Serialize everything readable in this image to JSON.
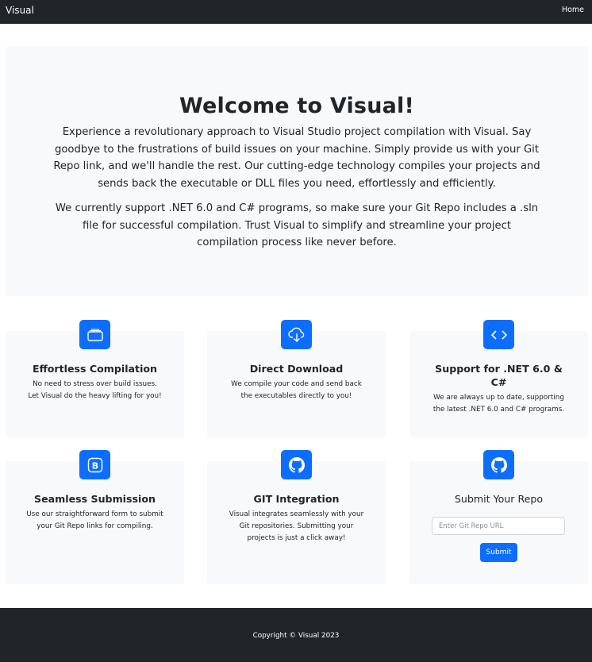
{
  "navbar": {
    "brand": "Visual",
    "links": [
      {
        "label": "Home"
      }
    ]
  },
  "hero": {
    "title": "Welcome to Visual!",
    "paragraphs": [
      "Experience a revolutionary approach to Visual Studio project compilation with Visual. Say goodbye to the frustrations of build issues on your machine. Simply provide us with your Git Repo link, and we'll handle the rest. Our cutting-edge technology compiles your projects and sends back the executable or DLL files you need, effortlessly and efficiently.",
      "We currently support .NET 6.0 and C# programs, so make sure your Git Repo includes a .sln file for successful compilation. Trust Visual to simplify and streamline your project compilation process like never before."
    ]
  },
  "features": [
    {
      "icon": "folder-icon",
      "title": "Effortless Compilation",
      "text": "No need to stress over build issues. Let Visual do the heavy lifting for you!"
    },
    {
      "icon": "cloud-download-icon",
      "title": "Direct Download",
      "text": "We compile your code and send back the executables directly to you!"
    },
    {
      "icon": "code-icon",
      "title": "Support for .NET 6.0 & C#",
      "text": "We are always up to date, supporting the latest .NET 6.0 and C# programs."
    },
    {
      "icon": "bootstrap-icon",
      "title": "Seamless Submission",
      "text": "Use our straightforward form to submit your Git Repo links for compiling."
    },
    {
      "icon": "github-icon",
      "title": "GIT Integration",
      "text": "Visual integrates seamlessly with your Git repositories. Submitting your projects is just a click away!"
    }
  ],
  "submit_form": {
    "icon": "github-icon",
    "title": "Submit Your Repo",
    "input_value": "",
    "input_placeholder": "Enter Git Repo URL",
    "button_label": "Submit"
  },
  "footer": {
    "copyright": "Copyright © Visual 2023"
  },
  "colors": {
    "navbar": "#212529",
    "accent": "#0d6efd",
    "panel": "#f8f9fa"
  }
}
